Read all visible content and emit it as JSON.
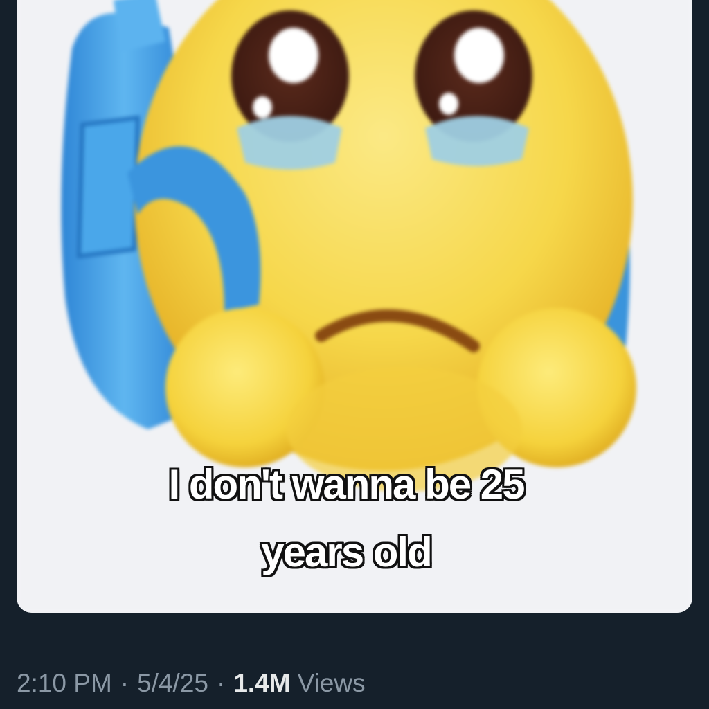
{
  "post": {
    "media": {
      "caption_line_1": "I don't wanna be 25",
      "caption_line_2": "years old",
      "image_subject": "pleading-face-emoji-with-backpack"
    },
    "meta": {
      "time": "2:10 PM",
      "separator": "·",
      "date": "5/4/25",
      "views_count": "1.4M",
      "views_label": "Views"
    }
  },
  "colors": {
    "background": "#15202b",
    "media_bg": "#f1f2f5",
    "muted_text": "#8b98a5",
    "strong_text": "#e7e9ea",
    "emoji_yellow": "#f7d94a",
    "backpack_blue": "#3d9be0"
  }
}
